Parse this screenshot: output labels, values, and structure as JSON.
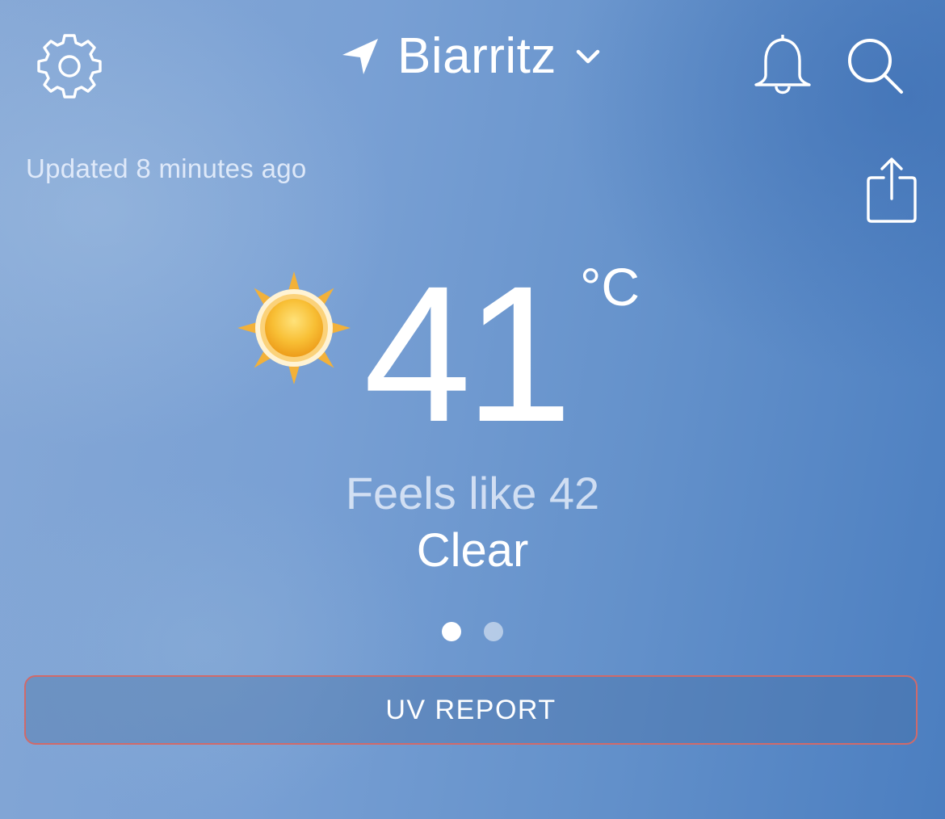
{
  "header": {
    "location": "Biarritz",
    "icons": {
      "settings": "gear-icon",
      "location": "location-arrow-icon",
      "dropdown": "chevron-down-icon",
      "notifications": "bell-icon",
      "search": "search-icon",
      "share": "share-icon"
    }
  },
  "status": {
    "updated": "Updated 8 minutes ago"
  },
  "current": {
    "temperature": "41",
    "unit": "°C",
    "feels_like": "Feels like 42",
    "condition": "Clear",
    "condition_icon": "sun-icon"
  },
  "pager": {
    "count": 2,
    "active_index": 0
  },
  "actions": {
    "uv_report": "UV REPORT"
  },
  "colors": {
    "sky_left": "#86a8d6",
    "sky_right": "#4b7ec0",
    "button_border": "#d06a6a",
    "sun_core": "#f6b22b",
    "sun_rays": "#f2b13a"
  }
}
